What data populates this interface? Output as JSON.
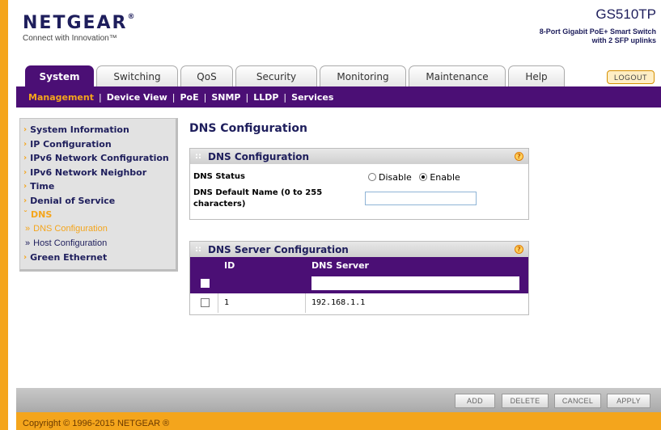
{
  "brand": {
    "logo": "NETGEAR",
    "registered": "®",
    "tagline": "Connect with Innovation™",
    "model": "GS510TP",
    "model_desc_line1": "8-Port Gigabit PoE+ Smart Switch",
    "model_desc_line2": "with 2 SFP uplinks"
  },
  "tabs": [
    {
      "label": "System",
      "active": true
    },
    {
      "label": "Switching",
      "active": false
    },
    {
      "label": "QoS",
      "active": false
    },
    {
      "label": "Security",
      "active": false
    },
    {
      "label": "Monitoring",
      "active": false
    },
    {
      "label": "Maintenance",
      "active": false
    },
    {
      "label": "Help",
      "active": false
    }
  ],
  "logout_label": "LOGOUT",
  "subnav": [
    {
      "label": "Management",
      "active": true
    },
    {
      "label": "Device View",
      "active": false
    },
    {
      "label": "PoE",
      "active": false
    },
    {
      "label": "SNMP",
      "active": false
    },
    {
      "label": "LLDP",
      "active": false
    },
    {
      "label": "Services",
      "active": false
    }
  ],
  "sidebar": {
    "items": [
      {
        "label": "System Information"
      },
      {
        "label": "IP Configuration"
      },
      {
        "label": "IPv6 Network Configuration"
      },
      {
        "label": "IPv6 Network Neighbor"
      },
      {
        "label": "Time"
      },
      {
        "label": "Denial of Service"
      },
      {
        "label": "DNS"
      },
      {
        "label": "Green Ethernet"
      }
    ],
    "dns_children": [
      {
        "label": "DNS Configuration"
      },
      {
        "label": "Host Configuration"
      }
    ]
  },
  "main": {
    "title": "DNS Configuration",
    "dns_panel": {
      "heading": "DNS Configuration",
      "status_label": "DNS Status",
      "disable_label": "Disable",
      "enable_label": "Enable",
      "status_value": "Enable",
      "default_name_label_line1": "DNS Default Name (0 to 255",
      "default_name_label_line2": "characters)",
      "default_name_value": ""
    },
    "server_panel": {
      "heading": "DNS Server Configuration",
      "columns": [
        "ID",
        "DNS Server"
      ],
      "new_server_value": "",
      "rows": [
        {
          "id": "1",
          "server": "192.168.1.1"
        }
      ]
    }
  },
  "buttons": {
    "add": "ADD",
    "delete": "DELETE",
    "cancel": "CANCEL",
    "apply": "APPLY"
  },
  "copyright": "Copyright © 1996-2015 NETGEAR ®",
  "colors": {
    "accent_orange": "#f4a51c",
    "nav_purple": "#4b0f75",
    "link_navy": "#1e1e5c"
  }
}
